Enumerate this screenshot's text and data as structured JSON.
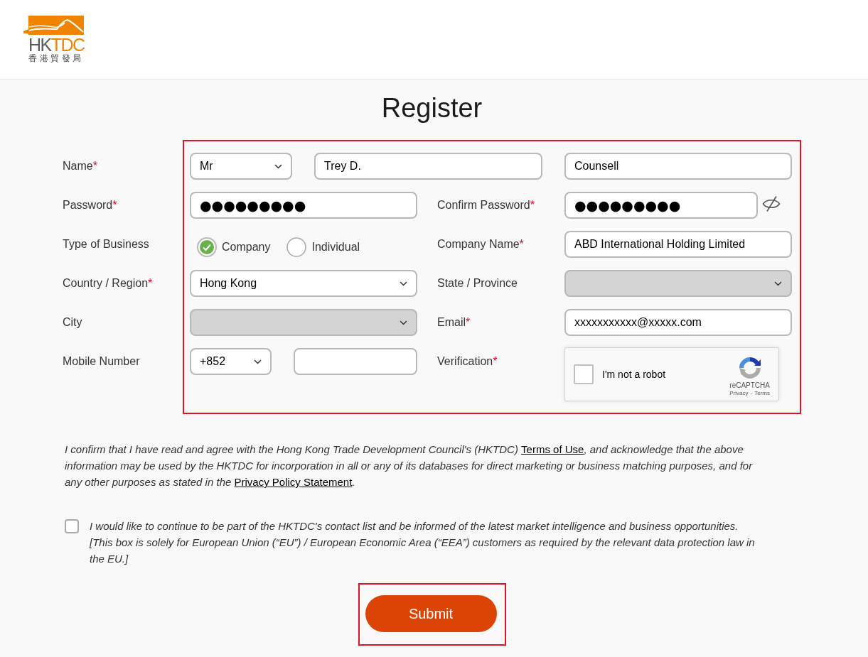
{
  "header": {
    "logo": {
      "wordmark": [
        "HK",
        "TDC"
      ],
      "subtitle": "香港貿發局"
    }
  },
  "title": "Register",
  "form": {
    "highlighted": true,
    "name": {
      "label": "Name",
      "required_mark": "*",
      "title": {
        "value": "Mr",
        "disabled": false
      },
      "first_name": "Trey D.",
      "last_name": "Counsell"
    },
    "password": {
      "label": "Password",
      "required_mark": "*",
      "value": "●●●●●●●●●"
    },
    "confirm_password": {
      "label": "Confirm Password",
      "required_mark": "*",
      "value": "●●●●●●●●●"
    },
    "business_type": {
      "label": "Type of Business",
      "options": [
        {
          "label": "Company",
          "selected": true
        },
        {
          "label": "Individual",
          "selected": false
        }
      ]
    },
    "company_name": {
      "label": "Company Name",
      "required_mark": "*",
      "value": "ABD International Holding Limited"
    },
    "country": {
      "label": "Country / Region",
      "required_mark": "*",
      "value": "Hong Kong",
      "disabled": false
    },
    "state": {
      "label": "State / Province",
      "disabled": true
    },
    "city": {
      "label": "City",
      "disabled": true
    },
    "email": {
      "label": "Email",
      "required_mark": "*",
      "value": "xxxxxxxxxxx@xxxxx.com"
    },
    "mobile": {
      "label": "Mobile Number",
      "country_code": {
        "value": "+852",
        "disabled": false
      }
    },
    "verification": {
      "label": "Verification",
      "required_mark": "*",
      "captcha": {
        "label": "I'm not a robot",
        "checked": false,
        "brand": "reCAPTCHA",
        "links": [
          "Privacy",
          "Terms"
        ],
        "separator": "-"
      }
    }
  },
  "consent": {
    "parts": [
      {
        "kind": "text",
        "text": "I confirm that I have read and agree with the Hong Kong Trade Development Council's (HKTDC) "
      },
      {
        "kind": "link",
        "text": "Terms of Use"
      },
      {
        "kind": "text",
        "text": ", and acknowledge that the above information may be used by the HKTDC for incorporation in all or any of its databases for direct marketing or business matching purposes, and for any other purposes as stated in the "
      },
      {
        "kind": "link",
        "text": "Privacy Policy Statement"
      },
      {
        "kind": "text",
        "text": "."
      }
    ]
  },
  "marketing_opt_in": {
    "checked": false,
    "text": "I would like to continue to be part of the HKTDC's contact list and be informed of the latest market intelligence and business opportunities. [This box is solely for European Union (“EU”) / European Economic Area (“EEA”) customers as required by the relevant data protection law in the EU.]"
  },
  "submit": {
    "label": "Submit",
    "highlighted": true
  }
}
